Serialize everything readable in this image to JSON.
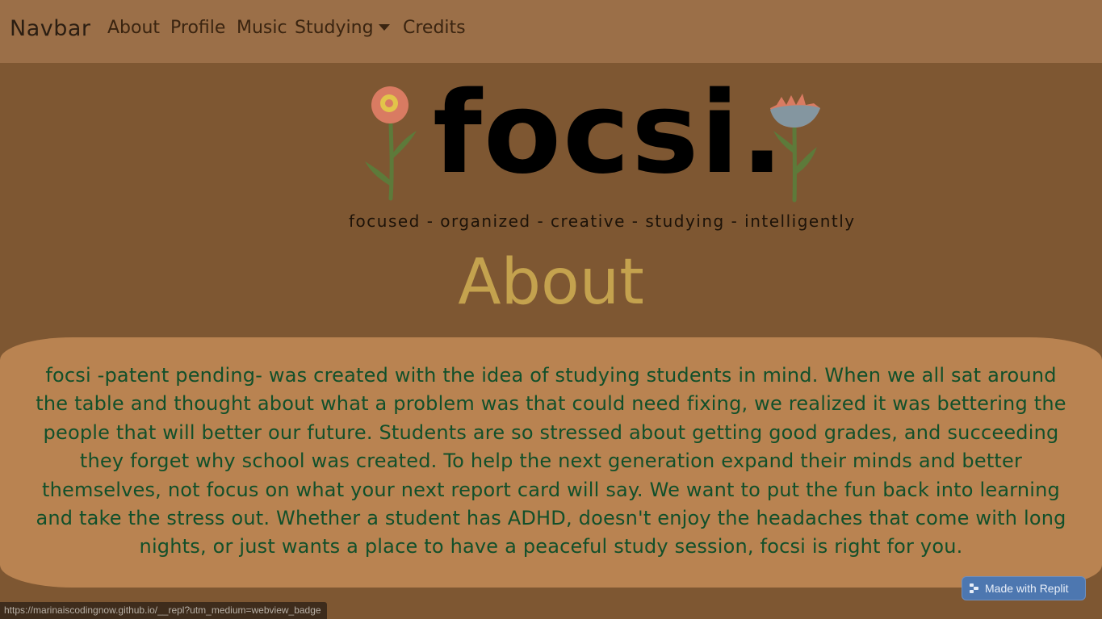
{
  "navbar": {
    "brand": "Navbar",
    "items": [
      {
        "label": "About"
      },
      {
        "label": "Profile"
      },
      {
        "label": "Music"
      },
      {
        "label": "Studying"
      },
      {
        "label": "Credits"
      }
    ]
  },
  "logo": {
    "text": "focsi.",
    "left_flower": "pink-flower-icon",
    "right_flower": "blue-flower-icon"
  },
  "tagline": "focused - organized - creative - studying - intelligently",
  "about": {
    "title": "About",
    "body": "focsi -patent pending- was created with the idea of studying students in mind. When we all sat around the table and thought about what a problem was that could need fixing, we realized it was bettering the people that will better our future. Students are so stressed about getting good grades, and succeeding they forget why school was created. To help the next generation expand their minds and better themselves, not focus on what your next report card will say. We want to put the fun back into learning and take the stress out. Whether a student has ADHD, doesn't enjoy the headaches that come with long nights, or just wants a place to have a peaceful study session, focsi is right for you."
  },
  "replit_badge": {
    "label": "Made with Replit",
    "icon": "replit-icon"
  },
  "status_bar": {
    "url": "https://marinaiscodingnow.github.io/__repl?utm_medium=webview_badge"
  },
  "colors": {
    "page_background": "#7e5732",
    "navbar_background": "#9b6f48",
    "title_color": "#c4a24e",
    "card_background": "#b98351",
    "body_text": "#12502a",
    "badge_background": "#4d77b0"
  }
}
